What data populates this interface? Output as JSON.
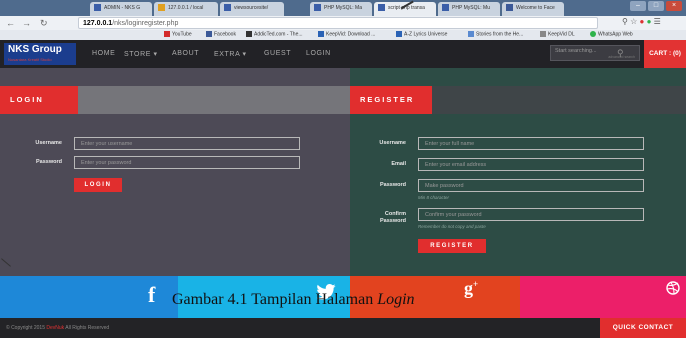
{
  "browser": {
    "tabs": [
      {
        "label": "ADMIN - NKS G",
        "color": "#3a5ea8"
      },
      {
        "label": "127.0.0.1 / local",
        "color": "#e0a020"
      },
      {
        "label": "viewsourcesite/",
        "color": "#3a5ea8"
      },
      {
        "label": "PHP MySQL: Ma",
        "color": "#3a5ea8"
      },
      {
        "label": "script php transa",
        "color": "#3a5ea8"
      },
      {
        "label": "PHP MySQL: Mu",
        "color": "#3a5ea8"
      },
      {
        "label": "Welcome to Face",
        "color": "#3b5998"
      }
    ],
    "url_host": "127.0.0.1",
    "url_path": "/nks/loginregister.php",
    "bookmarks": [
      {
        "label": "YouTube",
        "color": "#d32b2b"
      },
      {
        "label": "Facebook",
        "color": "#3b5998"
      },
      {
        "label": "AddicTed.com - The...",
        "color": "#333"
      },
      {
        "label": "KeepVid: Download ...",
        "color": "#2a62b5"
      },
      {
        "label": "A-Z Lyrics Universe",
        "color": "#2a62b5"
      },
      {
        "label": "Stories from the He...",
        "color": "#5a8ad0"
      },
      {
        "label": "KeepVid DL",
        "color": "#888"
      },
      {
        "label": "WhatsApp Web",
        "color": "#2eb34b"
      }
    ]
  },
  "navbar": {
    "brand": "NKS Group",
    "brand_tagline": "Nusantara Kreatif Studio",
    "items": [
      "HOME",
      "STORE",
      "ABOUT",
      "EXTRA",
      "GUEST",
      "LOGIN"
    ],
    "search_placeholder": "Start searching...",
    "search_advanced": "advanced search",
    "cart": "CART : (0)"
  },
  "login": {
    "title": "LOGIN",
    "username_label": "Username",
    "username_placeholder": "Enter your username",
    "password_label": "Password",
    "password_placeholder": "Enter your password",
    "button": "LOGIN"
  },
  "register": {
    "title": "REGISTER",
    "username_label": "Username",
    "username_placeholder": "Enter your full name",
    "email_label": "Email",
    "email_placeholder": "Enter your email address",
    "password_label": "Password",
    "password_placeholder": "Make password",
    "password_hint": "Min 8 character",
    "confirm_label_1": "Confirm",
    "confirm_label_2": "Password",
    "confirm_placeholder": "Confirm your password",
    "confirm_hint": "Remember do not copy and paste",
    "button": "REGISTER"
  },
  "social": {
    "facebook_color": "#1e88d8",
    "twitter_color": "#19b3e6",
    "google_color": "#e2431f",
    "dribbble_color": "#ec1f69"
  },
  "caption": {
    "prefix": "Gambar 4.1 Tampilan Halaman ",
    "emphasis": "Login"
  },
  "footer": {
    "copyright_prefix": "© Copyright 2015 ",
    "copyright_org": "DevNuk",
    "copyright_suffix": " All Rights Reserved",
    "quick_contact": "QUICK CONTACT"
  }
}
